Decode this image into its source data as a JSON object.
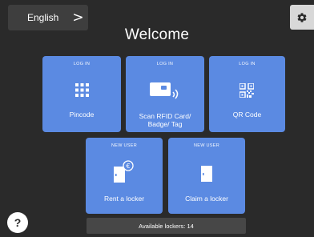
{
  "language": {
    "label": "English",
    "chevron": ">"
  },
  "settings": {
    "icon": "gear-icon"
  },
  "header": {
    "title": "Welcome"
  },
  "tiles": [
    {
      "tag": "LOG IN",
      "label": "Pincode",
      "icon": "keypad-icon"
    },
    {
      "tag": "LOG IN",
      "label": "Scan RFID Card/ Badge/ Tag",
      "icon": "rfid-card-icon"
    },
    {
      "tag": "LOG IN",
      "label": "QR Code",
      "icon": "qr-code-icon"
    },
    {
      "tag": "NEW USER",
      "label": "Rent a locker",
      "icon": "locker-euro-icon"
    },
    {
      "tag": "NEW USER",
      "label": "Claim a locker",
      "icon": "locker-icon"
    }
  ],
  "footer": {
    "available_lockers": "Available lockers: 14"
  },
  "help": {
    "label": "?"
  },
  "colors": {
    "background": "#2a2a2a",
    "tile": "#5b8ae2",
    "panel": "#3e3e3e"
  }
}
